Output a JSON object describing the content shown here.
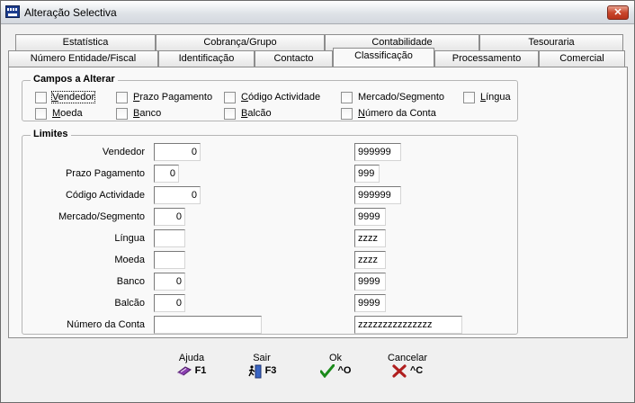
{
  "window": {
    "title": "Alteração Selectiva",
    "close": "✕"
  },
  "tabs": {
    "row1": [
      "Estatística",
      "Cobrança/Grupo",
      "Contabilidade",
      "Tesouraria"
    ],
    "row2": [
      "Número Entidade/Fiscal",
      "Identificação",
      "Contacto",
      "Classificação",
      "Processamento",
      "Comercial"
    ],
    "active": "Classificação"
  },
  "campos": {
    "title": "Campos a Alterar",
    "items": [
      "Vendedor",
      "Prazo Pagamento",
      "Código Actividade",
      "Mercado/Segmento",
      "Língua",
      "Moeda",
      "Banco",
      "Balcão",
      "Número da Conta"
    ]
  },
  "limites": {
    "title": "Limites",
    "rows": [
      {
        "label": "Vendedor",
        "from": "0",
        "to": "999999"
      },
      {
        "label": "Prazo Pagamento",
        "from": "0",
        "to": "999"
      },
      {
        "label": "Código Actividade",
        "from": "0",
        "to": "999999"
      },
      {
        "label": "Mercado/Segmento",
        "from": "0",
        "to": "9999"
      },
      {
        "label": "Língua",
        "from": "",
        "to": "zzzz"
      },
      {
        "label": "Moeda",
        "from": "",
        "to": "zzzz"
      },
      {
        "label": "Banco",
        "from": "0",
        "to": "9999"
      },
      {
        "label": "Balcão",
        "from": "0",
        "to": "9999"
      },
      {
        "label": "Número da Conta",
        "from": "",
        "to": "zzzzzzzzzzzzzzz"
      }
    ]
  },
  "footer": {
    "ajuda": {
      "caption": "Ajuda",
      "key": "F1"
    },
    "sair": {
      "caption": "Sair",
      "key": "F3"
    },
    "ok": {
      "caption": "Ok",
      "key": "^O"
    },
    "cancelar": {
      "caption": "Cancelar",
      "key": "^C"
    }
  },
  "colors": {
    "ok": "#1a8a1a",
    "cancel": "#b01e1e",
    "help": "#8a3fb0"
  }
}
